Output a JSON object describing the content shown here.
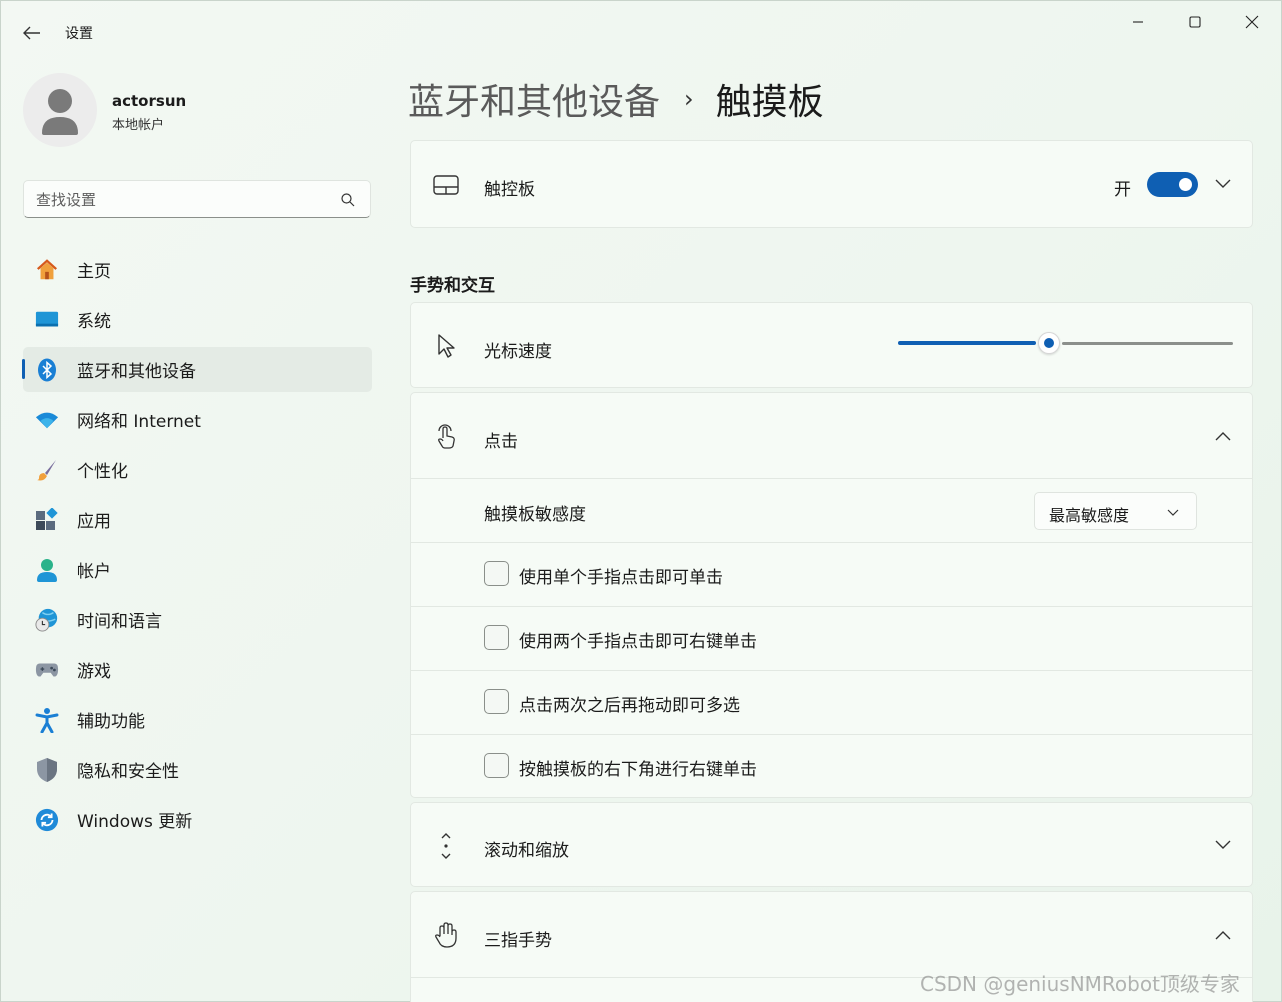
{
  "window": {
    "app_title": "设置",
    "controls": {
      "minimize": "minimize-icon",
      "maximize": "maximize-icon",
      "close": "close-icon"
    }
  },
  "user": {
    "name": "actorsun",
    "account_type": "本地帐户"
  },
  "search": {
    "placeholder": "查找设置",
    "value": ""
  },
  "nav": {
    "items": [
      {
        "label": "主页",
        "icon": "home-icon",
        "selected": false
      },
      {
        "label": "系统",
        "icon": "system-icon",
        "selected": false
      },
      {
        "label": "蓝牙和其他设备",
        "icon": "bluetooth-icon",
        "selected": true
      },
      {
        "label": "网络和 Internet",
        "icon": "wifi-icon",
        "selected": false
      },
      {
        "label": "个性化",
        "icon": "brush-icon",
        "selected": false
      },
      {
        "label": "应用",
        "icon": "apps-icon",
        "selected": false
      },
      {
        "label": "帐户",
        "icon": "account-icon",
        "selected": false
      },
      {
        "label": "时间和语言",
        "icon": "globe-clock-icon",
        "selected": false
      },
      {
        "label": "游戏",
        "icon": "gamepad-icon",
        "selected": false
      },
      {
        "label": "辅助功能",
        "icon": "accessibility-icon",
        "selected": false
      },
      {
        "label": "隐私和安全性",
        "icon": "shield-icon",
        "selected": false
      },
      {
        "label": "Windows 更新",
        "icon": "update-icon",
        "selected": false
      }
    ]
  },
  "breadcrumb": {
    "parent": "蓝牙和其他设备",
    "separator": "›",
    "current": "触摸板"
  },
  "touchpad": {
    "label": "触控板",
    "state_label": "开",
    "enabled": true
  },
  "gestures": {
    "section_title": "手势和交互",
    "cursor_speed": {
      "label": "光标速度",
      "value_fraction": 0.45
    },
    "taps": {
      "label": "点击",
      "expanded": true,
      "sensitivity": {
        "label": "触摸板敏感度",
        "value": "最高敏感度"
      },
      "options": [
        {
          "label": "使用单个手指点击即可单击",
          "checked": false
        },
        {
          "label": "使用两个手指点击即可右键单击",
          "checked": false
        },
        {
          "label": "点击两次之后再拖动即可多选",
          "checked": false
        },
        {
          "label": "按触摸板的右下角进行右键单击",
          "checked": false
        }
      ]
    },
    "scroll_zoom": {
      "label": "滚动和缩放",
      "expanded": false
    },
    "three_finger": {
      "label": "三指手势",
      "expanded": true
    }
  },
  "colors": {
    "accent": "#0f5fb3",
    "selected_bg": "#e4ebe5"
  },
  "watermark": "CSDN @geniusNMRobot顶级专家"
}
